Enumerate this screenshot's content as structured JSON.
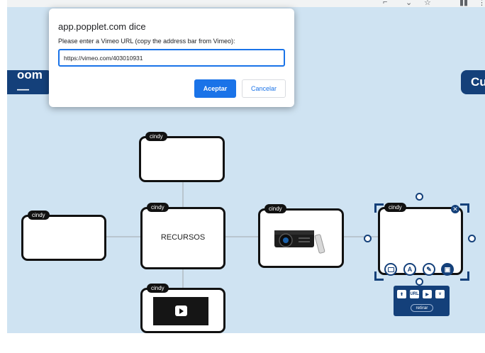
{
  "dialog": {
    "title": "app.popplet.com dice",
    "message": "Please enter a Vimeo URL (copy the address bar from Vimeo):",
    "input_value": "https://vimeo.com/403010931",
    "ok_label": "Aceptar",
    "cancel_label": "Cancelar"
  },
  "pills": {
    "left": "oom —",
    "right": "Cu"
  },
  "cards": {
    "top_tag": "cindy",
    "left_tag": "cindy",
    "center_tag": "cindy",
    "center_label": "RECURSOS",
    "projector_tag": "cindy",
    "video_tag": "cindy",
    "selected_tag": "cindy"
  },
  "media_panel": {
    "upload_icon": "upload-icon",
    "url_label": "URL",
    "youtube_icon": "youtube-icon",
    "vimeo_icon": "vimeo-icon",
    "remove_label": "retirar"
  },
  "toolbar_icons": [
    "square-icon",
    "text-icon",
    "pencil-icon",
    "image-icon"
  ],
  "colors": {
    "canvas": "#cfe3f2",
    "accent": "#14407a",
    "button": "#1a73e8"
  }
}
